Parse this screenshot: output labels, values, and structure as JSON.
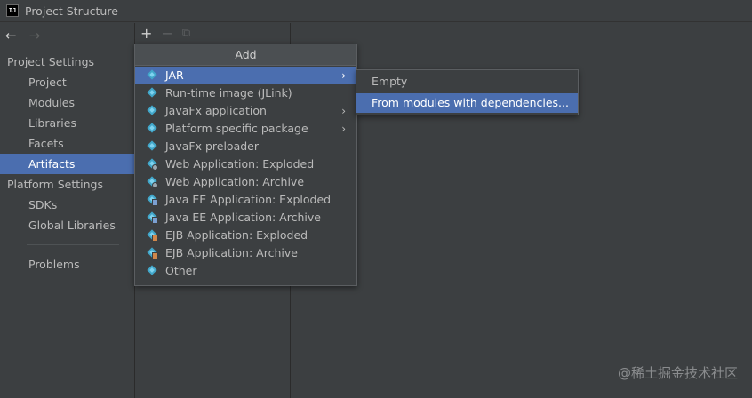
{
  "window": {
    "logo_text": "IJ",
    "title": "Project Structure"
  },
  "nav": {
    "back_glyph": "←",
    "forward_glyph": "→",
    "project_settings": {
      "header": "Project Settings",
      "items": [
        "Project",
        "Modules",
        "Libraries",
        "Facets",
        "Artifacts"
      ]
    },
    "platform_settings": {
      "header": "Platform Settings",
      "items": [
        "SDKs",
        "Global Libraries"
      ]
    },
    "problems": "Problems",
    "selected": "Artifacts"
  },
  "toolbar": {
    "add": "+",
    "remove": "−",
    "copy": "⧉"
  },
  "add_menu": {
    "title": "Add",
    "items": [
      {
        "label": "JAR",
        "icon": "artifact-icon",
        "submenu": true,
        "selected": true
      },
      {
        "label": "Run-time image (JLink)",
        "icon": "artifact-icon",
        "submenu": false
      },
      {
        "label": "JavaFx application",
        "icon": "artifact-icon",
        "submenu": true
      },
      {
        "label": "Platform specific package",
        "icon": "artifact-icon",
        "submenu": true
      },
      {
        "label": "JavaFx preloader",
        "icon": "artifact-icon",
        "submenu": false
      },
      {
        "label": "Web Application: Exploded",
        "icon": "web-artifact-icon",
        "submenu": false
      },
      {
        "label": "Web Application: Archive",
        "icon": "web-artifact-icon",
        "submenu": false
      },
      {
        "label": "Java EE Application: Exploded",
        "icon": "javaee-artifact-icon",
        "submenu": false
      },
      {
        "label": "Java EE Application: Archive",
        "icon": "javaee-artifact-icon",
        "submenu": false
      },
      {
        "label": "EJB Application: Exploded",
        "icon": "ejb-artifact-icon",
        "submenu": false
      },
      {
        "label": "EJB Application: Archive",
        "icon": "ejb-artifact-icon",
        "submenu": false
      },
      {
        "label": "Other",
        "icon": "artifact-icon",
        "submenu": false
      }
    ],
    "submenu_arrow": "›"
  },
  "jar_submenu": {
    "items": [
      "Empty",
      "From modules with dependencies..."
    ],
    "selected": "From modules with dependencies..."
  },
  "watermark": "@稀土掘金技术社区",
  "colors": {
    "background": "#3c3f41",
    "selection": "#4b6eaf",
    "artifact_icon": "#41a6c9",
    "text": "#bbbbbb"
  }
}
